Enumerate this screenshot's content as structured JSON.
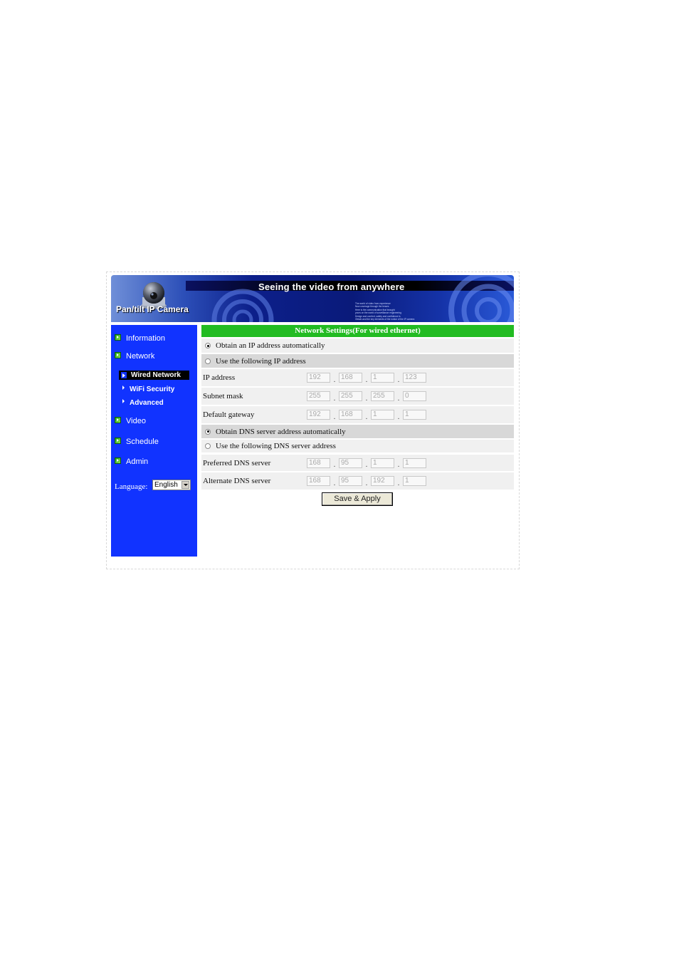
{
  "banner": {
    "tagline": "Seeing the video from anywhere",
    "brand": "Pan/tilt IP Camera",
    "fine_print": [
      "The world of video from experience",
      "Now coverage through the lenses",
      "Here is the communication that brought",
      "yours on the world of surveillance engineering",
      "Design and comfort, safety and confidence is",
      "Obtain and the key elements of the notion of the IP camera"
    ]
  },
  "sidebar": {
    "items": [
      {
        "label": "Information"
      },
      {
        "label": "Network"
      },
      {
        "label": "Video"
      },
      {
        "label": "Schedule"
      },
      {
        "label": "Admin"
      }
    ],
    "network_sub": [
      {
        "label": "Wired Network",
        "active": true
      },
      {
        "label": "WiFi Security"
      },
      {
        "label": "Advanced"
      }
    ],
    "language_label": "Language:",
    "language_value": "English"
  },
  "main": {
    "title": "Network Settings(For wired ethernet)",
    "ip_auto_label": "Obtain an IP address automatically",
    "ip_manual_label": "Use the following IP address",
    "ip_mode": "auto",
    "fields": [
      {
        "label": "IP address",
        "octets": [
          "192",
          "168",
          "1",
          "123"
        ]
      },
      {
        "label": "Subnet mask",
        "octets": [
          "255",
          "255",
          "255",
          "0"
        ]
      },
      {
        "label": "Default gateway",
        "octets": [
          "192",
          "168",
          "1",
          "1"
        ]
      }
    ],
    "dns_auto_label": "Obtain DNS server address automatically",
    "dns_manual_label": "Use the following DNS server address",
    "dns_mode": "auto",
    "dns_fields": [
      {
        "label": "Preferred DNS server",
        "octets": [
          "168",
          "95",
          "1",
          "1"
        ]
      },
      {
        "label": "Alternate DNS server",
        "octets": [
          "168",
          "95",
          "192",
          "1"
        ]
      }
    ],
    "save_label": "Save & Apply"
  },
  "colors": {
    "sidebar": "#1133ff",
    "title_bar": "#22bb22",
    "row_grey": "#d8d8d8",
    "row_light": "#f0f0f0"
  }
}
